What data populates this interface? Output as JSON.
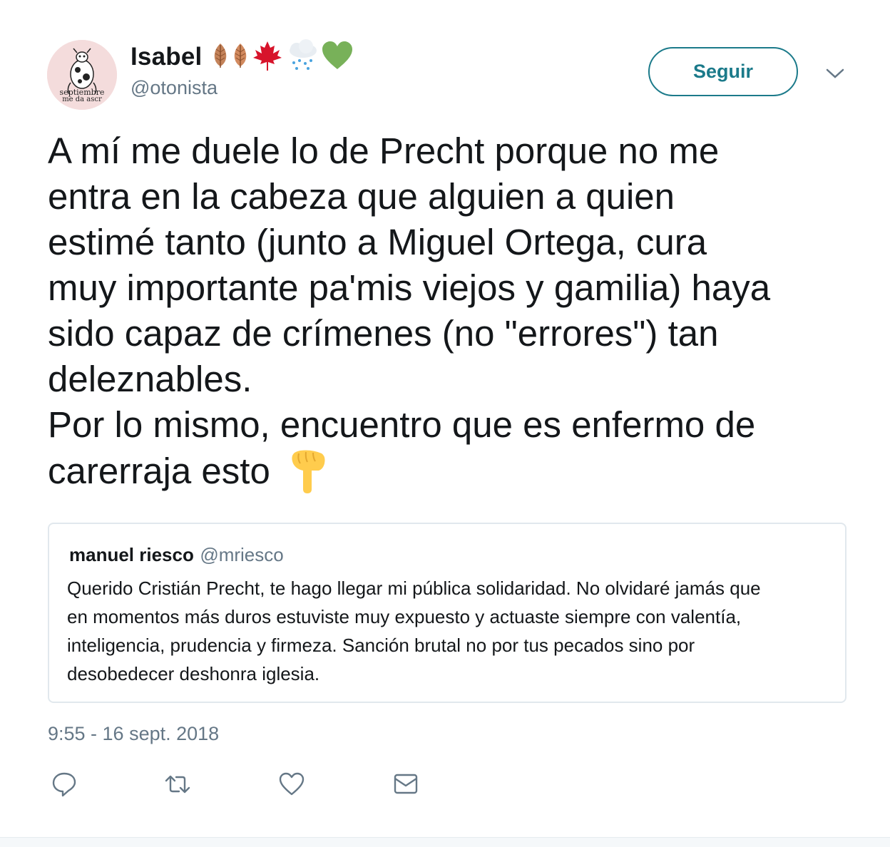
{
  "user": {
    "display_name": "Isabel",
    "screen_name": "@otonista",
    "avatar_caption_top": "septiembre",
    "avatar_caption_bottom": "me da ascr",
    "name_emojis": [
      "leaf-icon",
      "leaf-icon",
      "maple-leaf-icon",
      "rain-cloud-icon",
      "green-heart-icon"
    ]
  },
  "follow_button": {
    "label": "Seguir"
  },
  "tweet": {
    "lines": [
      "A mí me duele lo de Precht porque no me",
      "entra en la cabeza que alguien a quien",
      "estimé tanto (junto a Miguel Ortega, cura",
      "muy importante pa'mis viejos y gamilia) haya",
      "sido capaz de crímenes (no \"errores\") tan",
      "deleznables.",
      "Por lo mismo, encuentro que es enfermo de",
      "carerraja esto"
    ],
    "trailing_emoji": "pointing-down-icon",
    "timestamp": "9:55 - 16 sept. 2018"
  },
  "quoted_tweet": {
    "name": "manuel riesco",
    "handle": "@mriesco",
    "lines": [
      "Querido Cristián Precht, te hago llegar mi pública solidaridad. No olvidaré jamás que",
      "en momentos más duros estuviste muy expuesto y actuaste siempre con valentía,",
      "inteligencia, prudencia y firmeza. Sanción brutal no por tus pecados sino por",
      "desobedecer deshonra iglesia."
    ]
  },
  "actions": [
    "reply-icon",
    "retweet-icon",
    "like-icon",
    "direct-message-icon"
  ],
  "colors": {
    "text": "#14171a",
    "secondary": "#657786",
    "accent": "#1b7a8a",
    "border": "#e1e8ed",
    "background": "#ffffff"
  }
}
